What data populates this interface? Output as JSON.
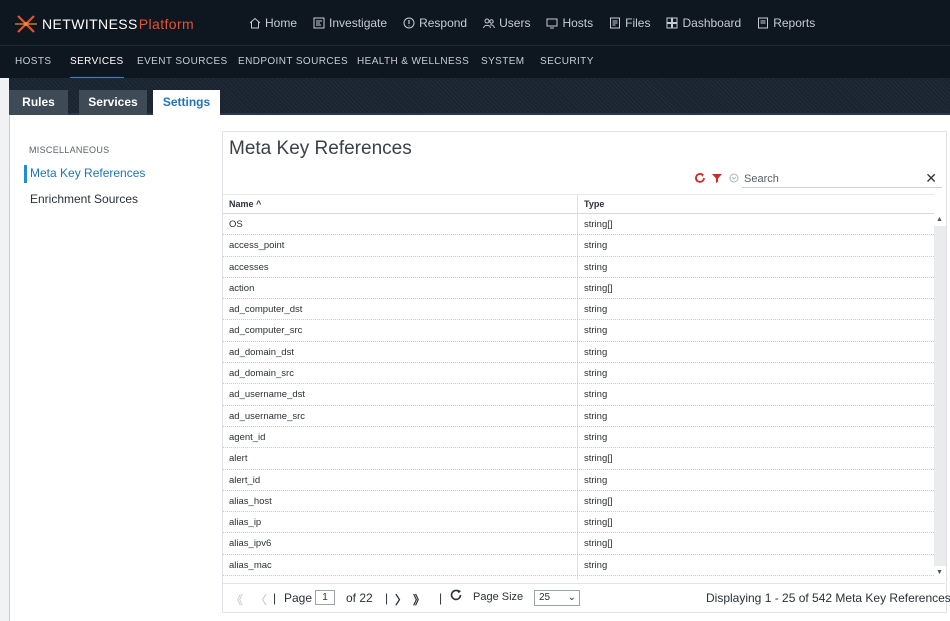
{
  "brand": {
    "name": "NETWITNESS",
    "product": "Platform"
  },
  "main_nav": [
    {
      "label": "Home",
      "icon": "home-icon"
    },
    {
      "label": "Investigate",
      "icon": "investigate-icon"
    },
    {
      "label": "Respond",
      "icon": "respond-icon"
    },
    {
      "label": "Users",
      "icon": "users-icon"
    },
    {
      "label": "Hosts",
      "icon": "hosts-icon"
    },
    {
      "label": "Files",
      "icon": "files-icon"
    },
    {
      "label": "Dashboard",
      "icon": "dashboard-icon"
    },
    {
      "label": "Reports",
      "icon": "reports-icon"
    }
  ],
  "sub_nav": [
    "HOSTS",
    "SERVICES",
    "EVENT SOURCES",
    "ENDPOINT SOURCES",
    "HEALTH & WELLNESS",
    "SYSTEM",
    "SECURITY"
  ],
  "sub_nav_active": "SERVICES",
  "page_tabs": [
    "Rules",
    "Services",
    "Settings"
  ],
  "page_tabs_active": "Settings",
  "sidebar": {
    "section": "MISCELLANEOUS",
    "items": [
      "Meta Key References",
      "Enrichment Sources"
    ],
    "active": "Meta Key References"
  },
  "main": {
    "title": "Meta Key References",
    "search_placeholder": "Search",
    "clear_glyph": "✕",
    "columns": {
      "name": "Name ^",
      "type": "Type"
    },
    "rows": [
      {
        "name": "OS",
        "type": "string[]"
      },
      {
        "name": "access_point",
        "type": "string"
      },
      {
        "name": "accesses",
        "type": "string"
      },
      {
        "name": "action",
        "type": "string[]"
      },
      {
        "name": "ad_computer_dst",
        "type": "string"
      },
      {
        "name": "ad_computer_src",
        "type": "string"
      },
      {
        "name": "ad_domain_dst",
        "type": "string"
      },
      {
        "name": "ad_domain_src",
        "type": "string"
      },
      {
        "name": "ad_username_dst",
        "type": "string"
      },
      {
        "name": "ad_username_src",
        "type": "string"
      },
      {
        "name": "agent_id",
        "type": "string"
      },
      {
        "name": "alert",
        "type": "string[]"
      },
      {
        "name": "alert_id",
        "type": "string"
      },
      {
        "name": "alias_host",
        "type": "string[]"
      },
      {
        "name": "alias_ip",
        "type": "string[]"
      },
      {
        "name": "alias_ipv6",
        "type": "string[]"
      },
      {
        "name": "alias_mac",
        "type": "string"
      }
    ]
  },
  "pager": {
    "first": "《",
    "prev": "〈",
    "page_label": "Page",
    "page_value": "1",
    "of_label": "of 22",
    "next": "〉",
    "last": "》",
    "page_size_label": "Page Size",
    "page_size_value": "25",
    "summary": "Displaying 1 - 25 of 542 Meta Key References",
    "separator": "|"
  },
  "colors": {
    "accent": "#1e8fd5",
    "brand_orange": "#e85230",
    "nav_bg": "#0e1620",
    "refresh_red": "#d62a2a"
  }
}
